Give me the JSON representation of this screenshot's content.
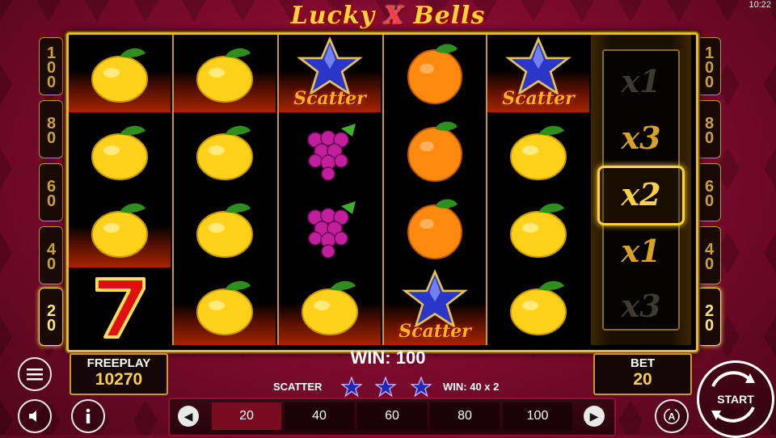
{
  "status": {
    "clock": "10:22"
  },
  "game": {
    "title_part1": "Lucky ",
    "title_x": "X",
    "title_part2": " Bells"
  },
  "lines_left": [
    "100",
    "80",
    "60",
    "40",
    "20"
  ],
  "lines_right": [
    "100",
    "80",
    "60",
    "40",
    "20"
  ],
  "active_line": "20",
  "reels": [
    [
      "lemon",
      "lemon",
      "lemon",
      "seven"
    ],
    [
      "lemon",
      "lemon",
      "lemon",
      "lemon"
    ],
    [
      "scatter",
      "grapes",
      "grapes",
      "lemon"
    ],
    [
      "orange",
      "orange",
      "orange",
      "scatter"
    ],
    [
      "scatter",
      "lemon",
      "lemon",
      "lemon"
    ]
  ],
  "fire_cells": [
    [
      0,
      0
    ],
    [
      0,
      2
    ],
    [
      1,
      0
    ],
    [
      1,
      3
    ],
    [
      2,
      0
    ],
    [
      2,
      3
    ],
    [
      3,
      3
    ],
    [
      4,
      0
    ]
  ],
  "scatter_text": "Scatter",
  "multipliers": [
    "x1",
    "x3",
    "x2",
    "x1",
    "x3"
  ],
  "selected_multiplier": "x2",
  "freeplay": {
    "label": "FREEPLAY",
    "value": "10270"
  },
  "win": {
    "text": "WIN: 100"
  },
  "scatter_win": {
    "label": "SCATTER",
    "stars": 3,
    "win": "WIN: 40 x 2"
  },
  "bet": {
    "label": "BET",
    "value": "20"
  },
  "bet_options": [
    "20",
    "40",
    "60",
    "80",
    "100"
  ],
  "active_bet": "20",
  "start_label": "START",
  "icons": {
    "menu": "hamburger-icon",
    "sound": "speaker-icon",
    "info": "info-icon",
    "auto": "autoplay-icon"
  },
  "colors": {
    "gold": "#e9b92f",
    "accent": "#ffd23d",
    "background": "#7a0a2c"
  }
}
